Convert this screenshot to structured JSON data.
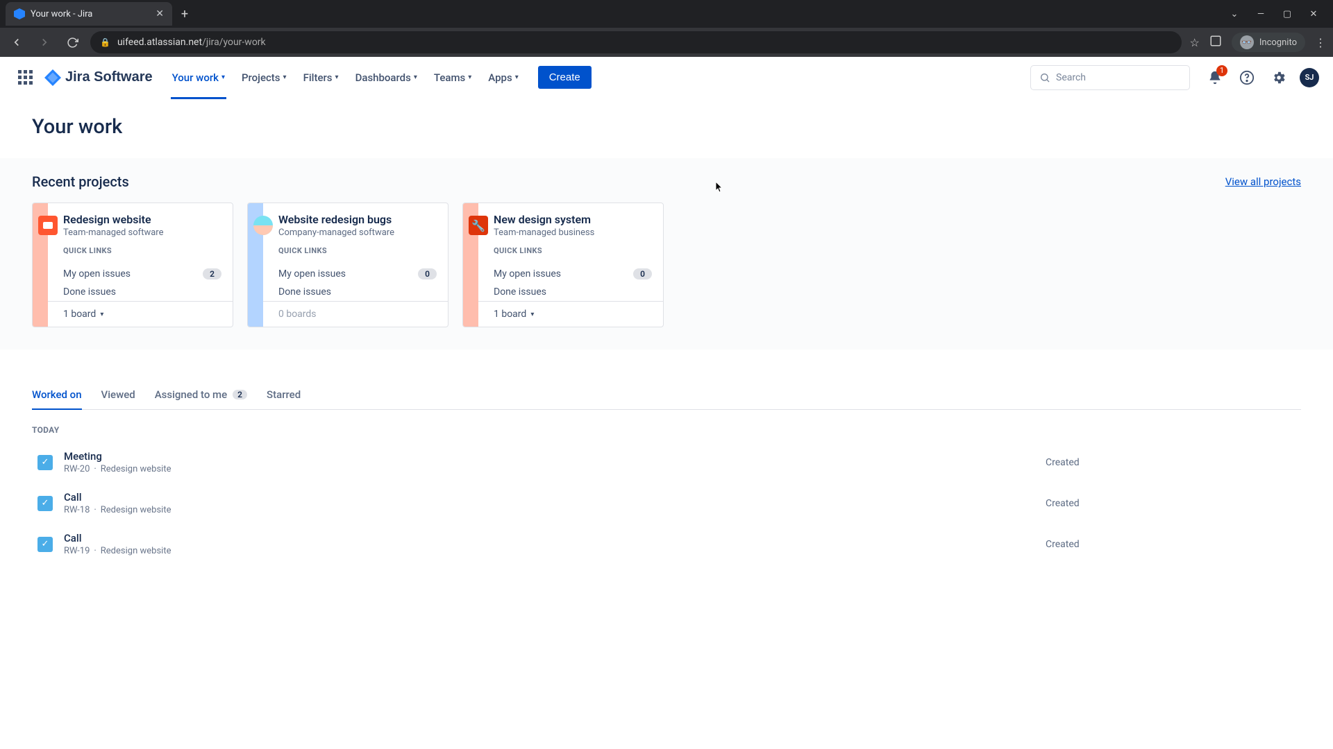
{
  "browser": {
    "tab_title": "Your work - Jira",
    "url_host": "uifeed.atlassian.net",
    "url_path": "/jira/your-work",
    "incognito_label": "Incognito"
  },
  "header": {
    "logo_text": "Jira Software",
    "nav": [
      "Your work",
      "Projects",
      "Filters",
      "Dashboards",
      "Teams",
      "Apps"
    ],
    "create_label": "Create",
    "search_placeholder": "Search",
    "notification_count": "1",
    "avatar_initials": "SJ"
  },
  "page": {
    "title": "Your work",
    "recent_title": "Recent projects",
    "view_all_label": "View all projects",
    "quick_links_label": "QUICK LINKS",
    "open_issues_label": "My open issues",
    "done_issues_label": "Done issues",
    "projects": [
      {
        "name": "Redesign website",
        "type": "Team-managed software",
        "open_count": "2",
        "boards": "1 board",
        "stripe": "stripe-red",
        "avatar": "pa-orange",
        "has_boards_menu": true
      },
      {
        "name": "Website redesign bugs",
        "type": "Company-managed software",
        "open_count": "0",
        "boards": "0 boards",
        "stripe": "stripe-blue",
        "avatar": "pa-face",
        "has_boards_menu": false
      },
      {
        "name": "New design system",
        "type": "Team-managed business",
        "open_count": "0",
        "boards": "1 board",
        "stripe": "stripe-red",
        "avatar": "pa-red",
        "has_boards_menu": true
      }
    ],
    "tabs": [
      {
        "label": "Worked on",
        "badge": null,
        "active": true
      },
      {
        "label": "Viewed",
        "badge": null,
        "active": false
      },
      {
        "label": "Assigned to me",
        "badge": "2",
        "active": false
      },
      {
        "label": "Starred",
        "badge": null,
        "active": false
      }
    ],
    "group_label": "TODAY",
    "issues": [
      {
        "title": "Meeting",
        "key": "RW-20",
        "project": "Redesign website",
        "status": "Created"
      },
      {
        "title": "Call",
        "key": "RW-18",
        "project": "Redesign website",
        "status": "Created"
      },
      {
        "title": "Call",
        "key": "RW-19",
        "project": "Redesign website",
        "status": "Created"
      }
    ]
  }
}
